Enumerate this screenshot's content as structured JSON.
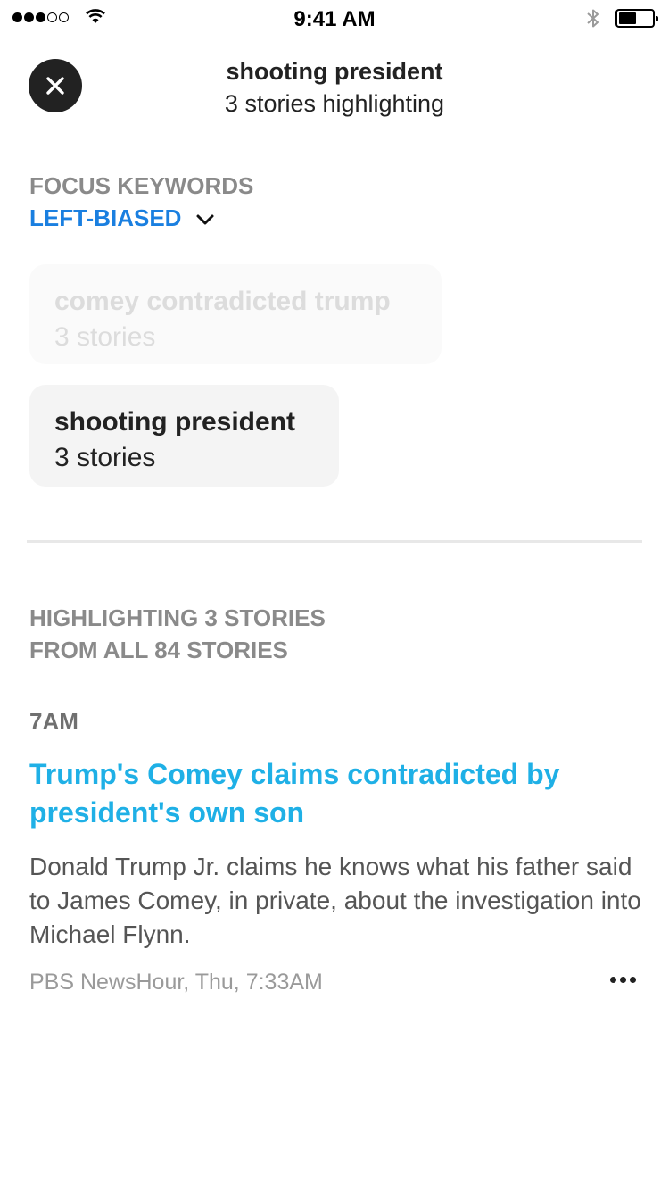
{
  "status_bar": {
    "time": "9:41 AM",
    "signal_bars_filled": 3,
    "signal_bars_total": 5,
    "battery_level": 0.45
  },
  "header": {
    "title": "shooting president",
    "subtitle": "3 stories highlighting",
    "close_icon": "close-icon"
  },
  "focus": {
    "label": "FOCUS KEYWORDS",
    "bias_label": "LEFT-BIASED",
    "bias_icon": "chevron-down-icon",
    "accent_color": "#1a7fe0"
  },
  "keywords": [
    {
      "title": "comey contradicted trump",
      "count": "3 stories",
      "state": "faded"
    },
    {
      "title": "shooting president",
      "count": "3 stories",
      "state": "active"
    }
  ],
  "highlight": {
    "line1": "HIGHLIGHTING 3 STORIES",
    "line2": "FROM ALL 84 STORIES"
  },
  "story": {
    "time_group": "7AM",
    "title": "Trump's Comey claims contradicted by president's own son",
    "body": "Donald Trump Jr. claims he knows what his father said to James Comey, in private, about the investigation into Michael Flynn.",
    "meta": "PBS NewsHour, Thu, 7:33AM",
    "title_color": "#1fb0e6",
    "more_icon": "more-dots-icon"
  }
}
